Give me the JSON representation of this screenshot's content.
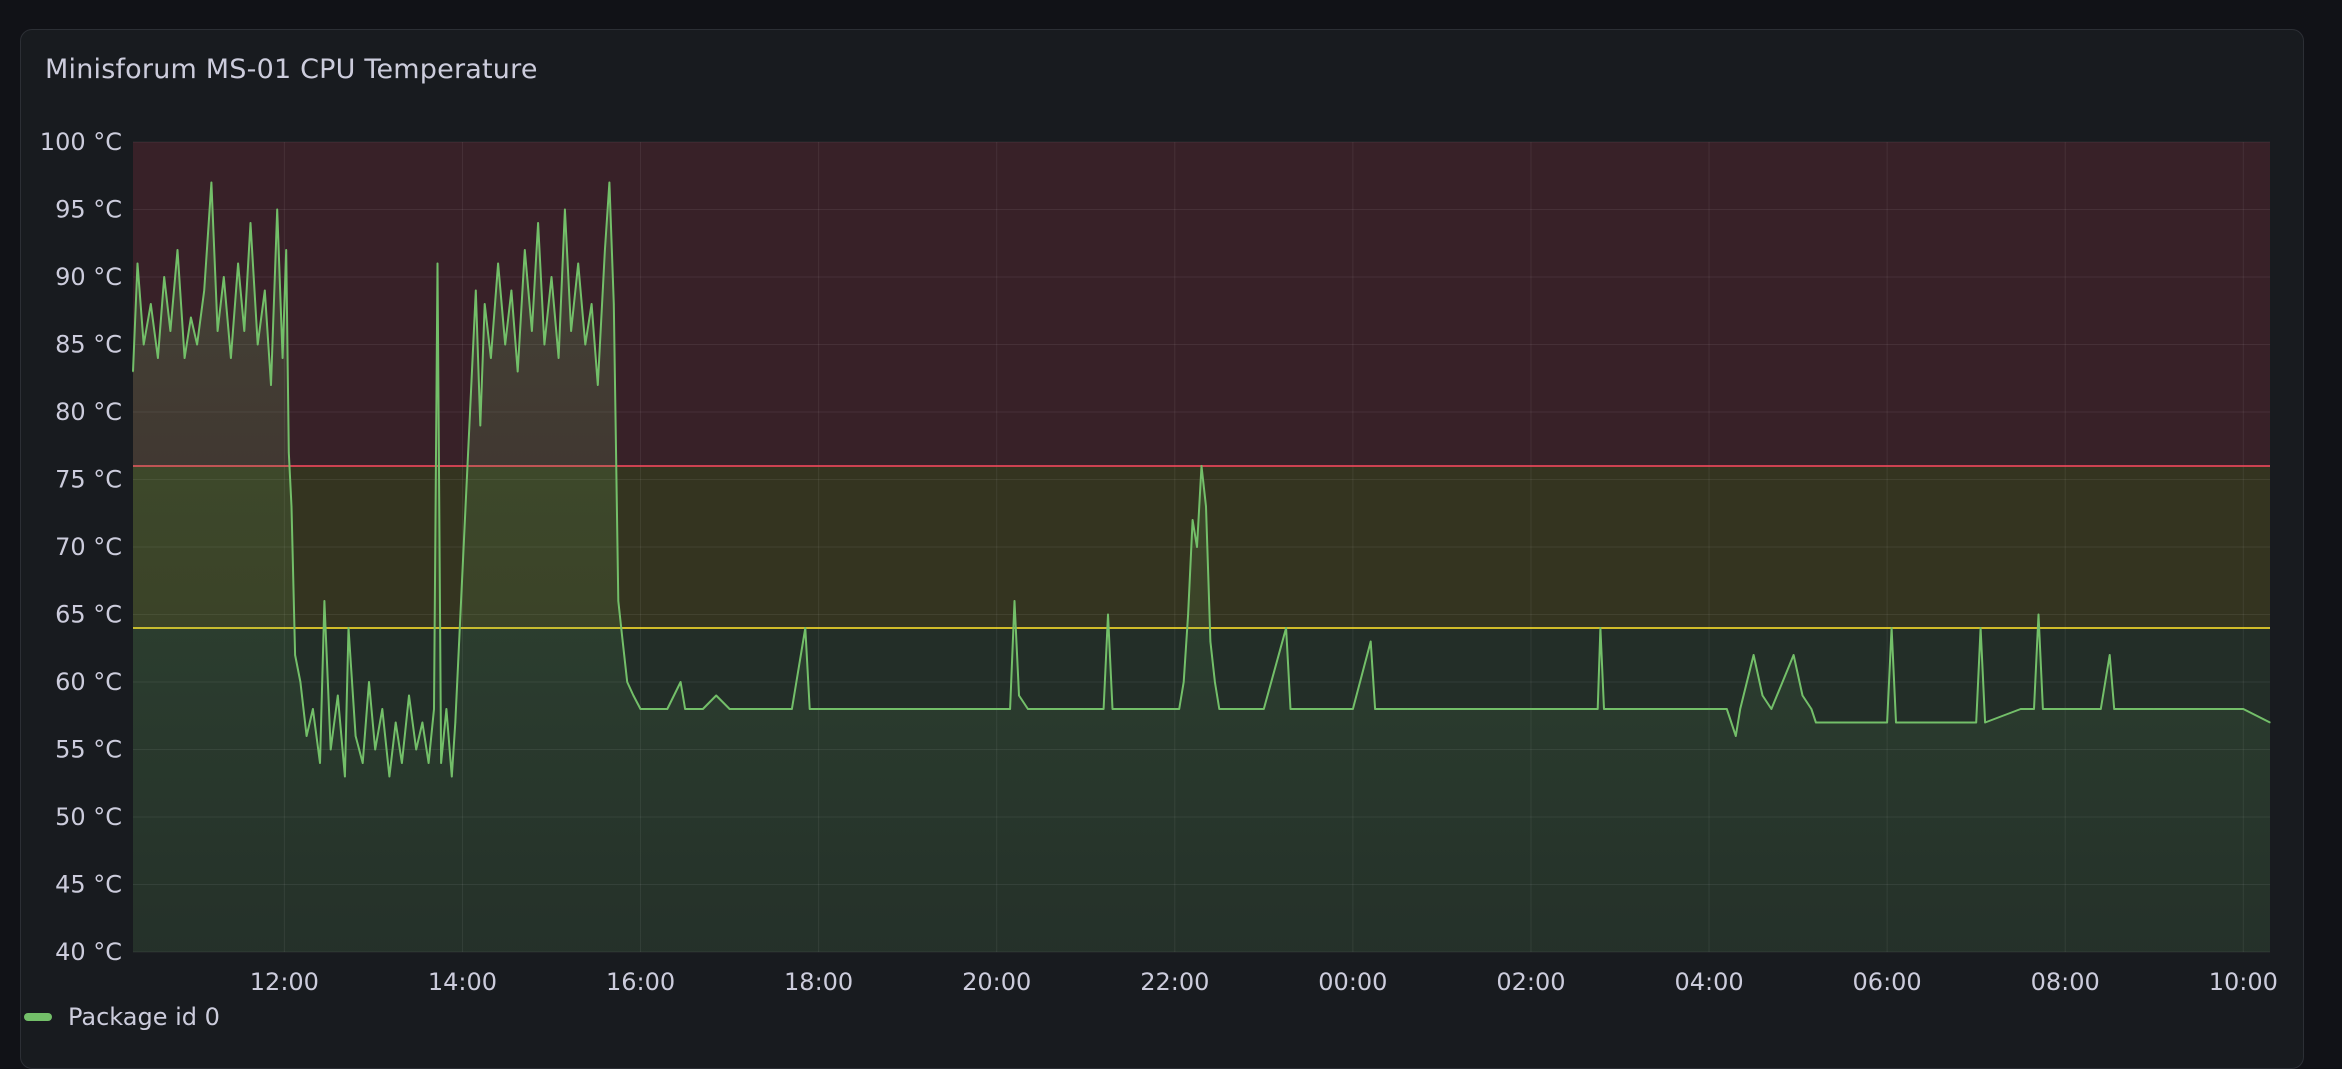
{
  "panel": {
    "title": "Minisforum MS-01 CPU Temperature"
  },
  "colors": {
    "series": "#73bf69",
    "red_band": "#f2495c",
    "yellow_band": "#fade2a",
    "green_band": "#73bf69"
  },
  "chart_data": {
    "type": "line",
    "title": "Minisforum MS-01 CPU Temperature",
    "xlabel": "",
    "ylabel": "",
    "y_unit": "°C",
    "ylim": [
      40,
      100
    ],
    "y_ticks": [
      "100 °C",
      "95 °C",
      "90 °C",
      "85 °C",
      "80 °C",
      "75 °C",
      "70 °C",
      "65 °C",
      "60 °C",
      "55 °C",
      "50 °C",
      "45 °C",
      "40 °C"
    ],
    "y_tick_values": [
      100,
      95,
      90,
      85,
      80,
      75,
      70,
      65,
      60,
      55,
      50,
      45,
      40
    ],
    "x_range_hours": [
      10.3,
      34.3
    ],
    "x_ticks": [
      "12:00",
      "14:00",
      "16:00",
      "18:00",
      "20:00",
      "22:00",
      "00:00",
      "02:00",
      "04:00",
      "06:00",
      "08:00",
      "10:00"
    ],
    "x_tick_hours": [
      12,
      14,
      16,
      18,
      20,
      22,
      24,
      26,
      28,
      30,
      32,
      34
    ],
    "grid": true,
    "legend_position": "bottom-left",
    "thresholds": [
      {
        "value": 64,
        "color": "yellow"
      },
      {
        "value": 76,
        "color": "red"
      }
    ],
    "series": [
      {
        "name": "Package id 0",
        "points": [
          [
            10.3,
            83
          ],
          [
            10.35,
            91
          ],
          [
            10.42,
            85
          ],
          [
            10.5,
            88
          ],
          [
            10.58,
            84
          ],
          [
            10.65,
            90
          ],
          [
            10.72,
            86
          ],
          [
            10.8,
            92
          ],
          [
            10.88,
            84
          ],
          [
            10.95,
            87
          ],
          [
            11.02,
            85
          ],
          [
            11.1,
            89
          ],
          [
            11.18,
            97
          ],
          [
            11.25,
            86
          ],
          [
            11.32,
            90
          ],
          [
            11.4,
            84
          ],
          [
            11.48,
            91
          ],
          [
            11.55,
            86
          ],
          [
            11.62,
            94
          ],
          [
            11.7,
            85
          ],
          [
            11.78,
            89
          ],
          [
            11.85,
            82
          ],
          [
            11.92,
            95
          ],
          [
            11.98,
            84
          ],
          [
            12.02,
            92
          ],
          [
            12.05,
            77
          ],
          [
            12.08,
            73
          ],
          [
            12.12,
            62
          ],
          [
            12.18,
            60
          ],
          [
            12.25,
            56
          ],
          [
            12.32,
            58
          ],
          [
            12.4,
            54
          ],
          [
            12.45,
            66
          ],
          [
            12.52,
            55
          ],
          [
            12.6,
            59
          ],
          [
            12.68,
            53
          ],
          [
            12.72,
            64
          ],
          [
            12.8,
            56
          ],
          [
            12.88,
            54
          ],
          [
            12.95,
            60
          ],
          [
            13.02,
            55
          ],
          [
            13.1,
            58
          ],
          [
            13.18,
            53
          ],
          [
            13.25,
            57
          ],
          [
            13.32,
            54
          ],
          [
            13.4,
            59
          ],
          [
            13.48,
            55
          ],
          [
            13.55,
            57
          ],
          [
            13.62,
            54
          ],
          [
            13.68,
            58
          ],
          [
            13.72,
            91
          ],
          [
            13.76,
            54
          ],
          [
            13.82,
            58
          ],
          [
            13.88,
            53
          ],
          [
            13.92,
            57
          ],
          [
            14.15,
            89
          ],
          [
            14.2,
            79
          ],
          [
            14.25,
            88
          ],
          [
            14.32,
            84
          ],
          [
            14.4,
            91
          ],
          [
            14.48,
            85
          ],
          [
            14.55,
            89
          ],
          [
            14.62,
            83
          ],
          [
            14.7,
            92
          ],
          [
            14.78,
            86
          ],
          [
            14.85,
            94
          ],
          [
            14.92,
            85
          ],
          [
            15.0,
            90
          ],
          [
            15.08,
            84
          ],
          [
            15.15,
            95
          ],
          [
            15.22,
            86
          ],
          [
            15.3,
            91
          ],
          [
            15.38,
            85
          ],
          [
            15.45,
            88
          ],
          [
            15.52,
            82
          ],
          [
            15.6,
            92
          ],
          [
            15.65,
            97
          ],
          [
            15.7,
            88
          ],
          [
            15.75,
            66
          ],
          [
            15.8,
            63
          ],
          [
            15.85,
            60
          ],
          [
            15.92,
            59
          ],
          [
            16.0,
            58
          ],
          [
            16.1,
            58
          ],
          [
            16.3,
            58
          ],
          [
            16.45,
            60
          ],
          [
            16.5,
            58
          ],
          [
            16.7,
            58
          ],
          [
            16.85,
            59
          ],
          [
            17.0,
            58
          ],
          [
            17.3,
            58
          ],
          [
            17.7,
            58
          ],
          [
            17.85,
            64
          ],
          [
            17.9,
            58
          ],
          [
            18.2,
            58
          ],
          [
            18.5,
            58
          ],
          [
            19.0,
            58
          ],
          [
            19.5,
            58
          ],
          [
            20.0,
            58
          ],
          [
            20.15,
            58
          ],
          [
            20.2,
            66
          ],
          [
            20.25,
            59
          ],
          [
            20.35,
            58
          ],
          [
            20.6,
            58
          ],
          [
            21.0,
            58
          ],
          [
            21.2,
            58
          ],
          [
            21.25,
            65
          ],
          [
            21.3,
            58
          ],
          [
            21.6,
            58
          ],
          [
            21.9,
            58
          ],
          [
            22.05,
            58
          ],
          [
            22.1,
            60
          ],
          [
            22.15,
            65
          ],
          [
            22.2,
            72
          ],
          [
            22.25,
            70
          ],
          [
            22.3,
            76
          ],
          [
            22.35,
            73
          ],
          [
            22.4,
            63
          ],
          [
            22.45,
            60
          ],
          [
            22.5,
            58
          ],
          [
            22.7,
            58
          ],
          [
            23.0,
            58
          ],
          [
            23.25,
            64
          ],
          [
            23.3,
            58
          ],
          [
            23.6,
            58
          ],
          [
            24.0,
            58
          ],
          [
            24.2,
            63
          ],
          [
            24.25,
            58
          ],
          [
            24.6,
            58
          ],
          [
            25.0,
            58
          ],
          [
            25.5,
            58
          ],
          [
            26.0,
            58
          ],
          [
            26.5,
            58
          ],
          [
            26.75,
            58
          ],
          [
            26.78,
            64
          ],
          [
            26.82,
            58
          ],
          [
            27.2,
            58
          ],
          [
            27.6,
            58
          ],
          [
            28.0,
            58
          ],
          [
            28.2,
            58
          ],
          [
            28.3,
            56
          ],
          [
            28.35,
            58
          ],
          [
            28.5,
            62
          ],
          [
            28.6,
            59
          ],
          [
            28.7,
            58
          ],
          [
            28.95,
            62
          ],
          [
            29.05,
            59
          ],
          [
            29.15,
            58
          ],
          [
            29.2,
            57
          ],
          [
            29.5,
            57
          ],
          [
            30.0,
            57
          ],
          [
            30.05,
            64
          ],
          [
            30.1,
            57
          ],
          [
            30.5,
            57
          ],
          [
            30.9,
            57
          ],
          [
            31.0,
            57
          ],
          [
            31.05,
            64
          ],
          [
            31.1,
            57
          ],
          [
            31.5,
            58
          ],
          [
            31.65,
            58
          ],
          [
            31.7,
            65
          ],
          [
            31.75,
            58
          ],
          [
            32.0,
            58
          ],
          [
            32.4,
            58
          ],
          [
            32.5,
            62
          ],
          [
            32.55,
            58
          ],
          [
            33.0,
            58
          ],
          [
            33.5,
            58
          ],
          [
            34.0,
            58
          ],
          [
            34.3,
            57
          ]
        ]
      }
    ]
  },
  "legend": {
    "items": [
      {
        "label": "Package id 0"
      }
    ]
  }
}
